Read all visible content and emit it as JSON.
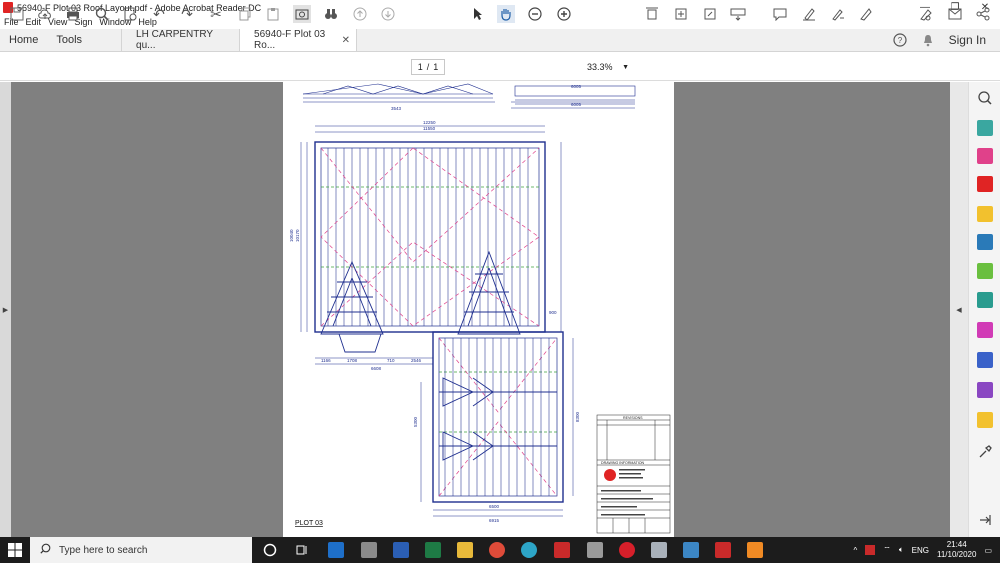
{
  "window": {
    "title": "56940-F Plot 03 Roof Layout.pdf - Adobe Acrobat Reader DC"
  },
  "menu": [
    "File",
    "Edit",
    "View",
    "Sign",
    "Window",
    "Help"
  ],
  "tabs": {
    "home": "Home",
    "tools": "Tools",
    "docs": [
      {
        "label": "LH CARPENTRY qu...",
        "active": false
      },
      {
        "label": "56940-F Plot 03 Ro...",
        "active": true
      }
    ],
    "sign_in": "Sign In"
  },
  "toolbar": {
    "page_current": "1",
    "page_sep": "/",
    "page_total": "1",
    "zoom": "33.3%"
  },
  "drawing": {
    "plot_label": "PLOT 03",
    "revisions_title": "REVISIONS",
    "drawing_info_title": "DRAWING INFORMATION",
    "dims": {
      "top1": "12250",
      "top2": "11550",
      "mid1": "6005",
      "mid2": "6005",
      "left": "3543",
      "bottom1": "1166",
      "bottom2": "1708",
      "bottom3": "710",
      "bottom4": "2546",
      "bottom_total": "6608",
      "lower_total": "6500",
      "lower_total2": "6915",
      "side1": "10040",
      "side2": "10170",
      "side3": "5300",
      "side4": "8300",
      "marker": "900"
    }
  },
  "taskbar": {
    "search_placeholder": "Type here to search",
    "lang": "ENG",
    "time": "21:44",
    "date": "11/10/2020"
  },
  "colors": {
    "acrobat_red": "#e02424",
    "blueprint": "#1f2f8f",
    "pink_dash": "#e0418a",
    "green": "#3da33d",
    "accent_blue": "#2a7ab8"
  }
}
